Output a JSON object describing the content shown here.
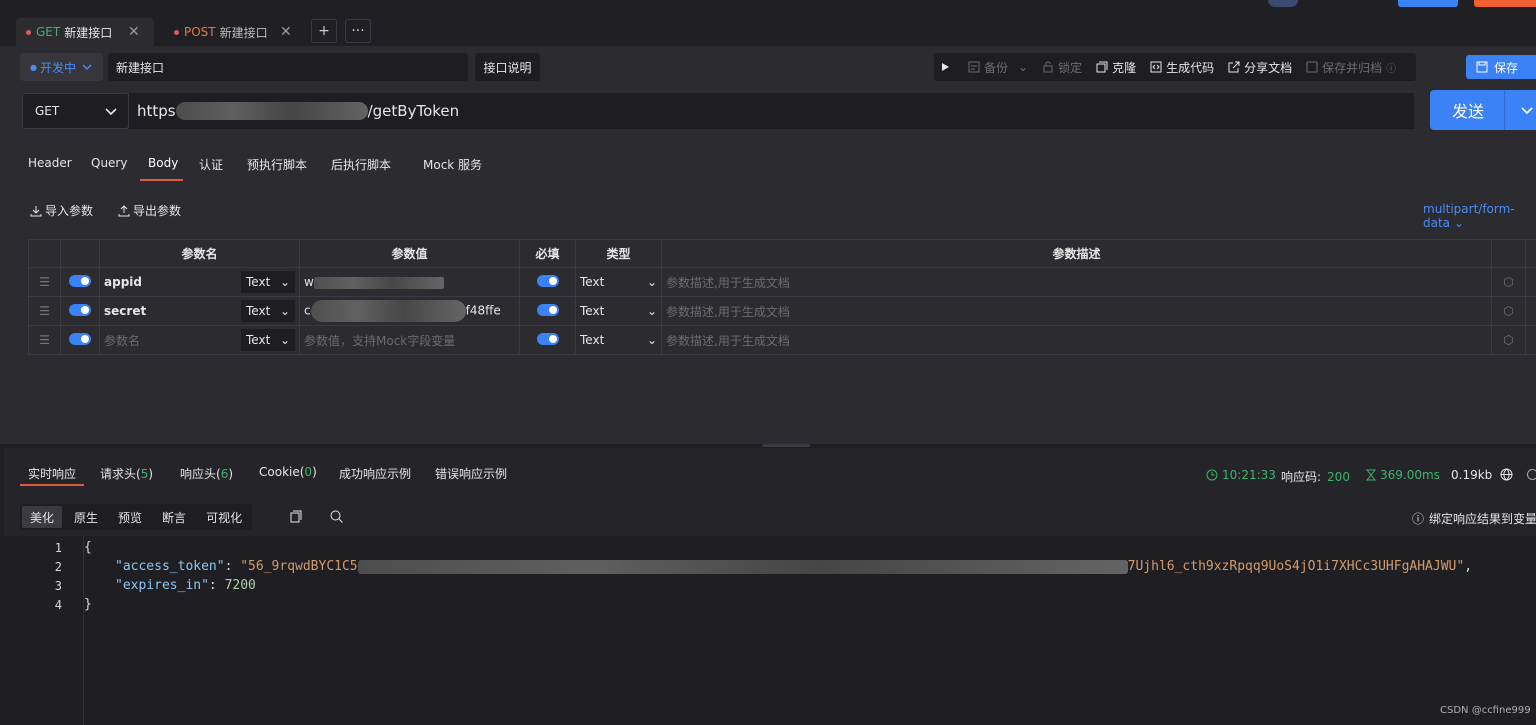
{
  "tabs": [
    {
      "method": "GET",
      "title": "新建接口",
      "active": true
    },
    {
      "method": "POST",
      "title": "新建接口",
      "active": false
    }
  ],
  "toolbar": {
    "env": "开发中",
    "name": "新建接口",
    "desc": "接口说明",
    "backup": "备份",
    "lock": "锁定",
    "clone": "克隆",
    "gencode": "生成代码",
    "share": "分享文档",
    "saveArchive": "保存并归档",
    "save": "保存"
  },
  "request": {
    "method": "GET",
    "url_prefix": "https",
    "url_suffix": "/getByToken",
    "send": "发送"
  },
  "reqtabs": [
    "Header",
    "Query",
    "Body",
    "认证",
    "预执行脚本",
    "后执行脚本",
    "Mock 服务"
  ],
  "body": {
    "import": "导入参数",
    "export": "导出参数",
    "content_type": "multipart/form-data",
    "headers": {
      "name": "参数名",
      "value": "参数值",
      "required": "必填",
      "type": "类型",
      "desc": "参数描述"
    },
    "rows": [
      {
        "name": "appid",
        "type": "Text",
        "value_start": "w",
        "value_end": "",
        "req_type": "Text",
        "desc_ph": "参数描述,用于生成文档"
      },
      {
        "name": "secret",
        "type": "Text",
        "value_start": "c",
        "value_end": "f48ffe",
        "req_type": "Text",
        "desc_ph": "参数描述,用于生成文档"
      },
      {
        "name_ph": "参数名",
        "type": "Text",
        "value_ph": "参数值，支持Mock字段变量",
        "req_type": "Text",
        "desc_ph": "参数描述,用于生成文档"
      }
    ]
  },
  "response": {
    "tabs": [
      {
        "label": "实时响应"
      },
      {
        "label": "请求头(",
        "n": "5",
        "end": ")"
      },
      {
        "label": "响应头(",
        "n": "6",
        "end": ")"
      },
      {
        "label": "Cookie(",
        "n": "0",
        "end": ")"
      },
      {
        "label": "成功响应示例"
      },
      {
        "label": "错误响应示例"
      }
    ],
    "time": "10:21:33",
    "code_label": "响应码:",
    "code": "200",
    "duration": "369.00ms",
    "size": "0.19kb",
    "bind": "绑定响应结果到变量",
    "views": [
      "美化",
      "原生",
      "预览",
      "断言",
      "可视化"
    ],
    "lines": [
      "1",
      "2",
      "3",
      "4"
    ],
    "json_open": "{",
    "json_close": "}",
    "key1": "\"access_token\"",
    "val1_start": "\"56_9rqwdBYC1C5",
    "val1_end": "7Ujhl6_cth9xzRpqq9UoS4jO1i7XHCc3UHFgAHAJWU\"",
    "key2": "\"expires_in\"",
    "val2": "7200"
  },
  "watermark": "CSDN @ccfine999"
}
